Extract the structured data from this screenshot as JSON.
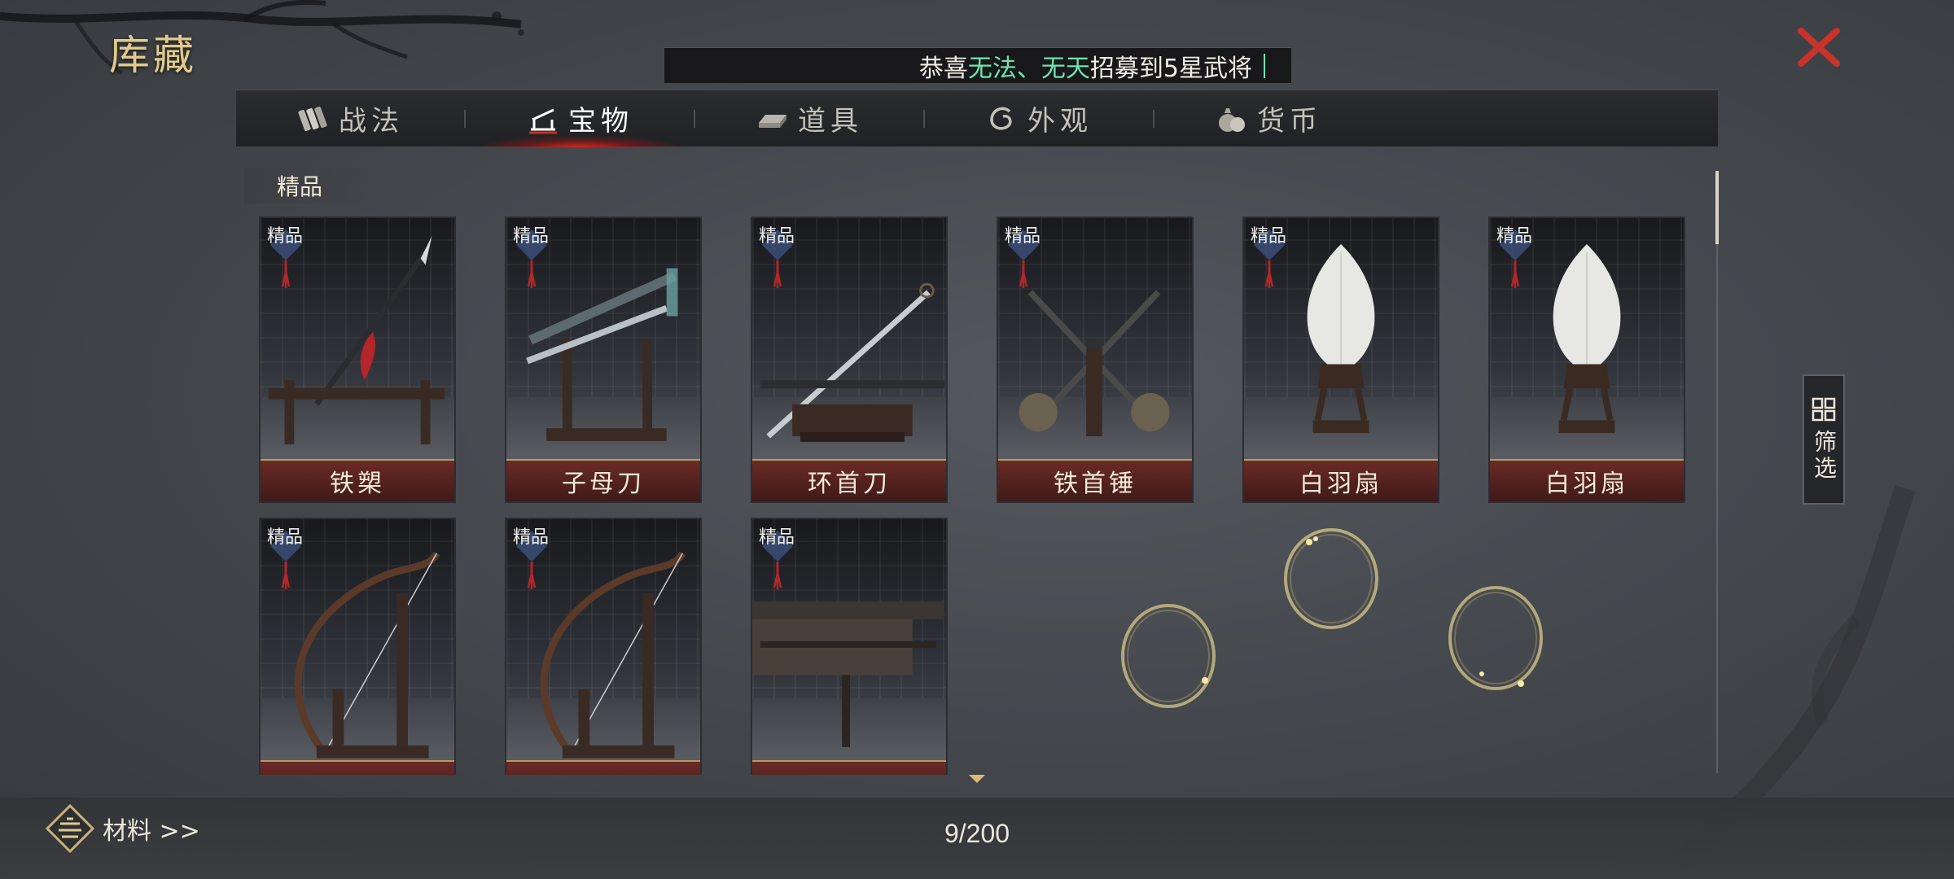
{
  "page": {
    "title": "库藏"
  },
  "announcement": {
    "prefix": "恭喜",
    "player1": "无法",
    "separator": "、",
    "player2": "无天",
    "suffix": "招募到5星武将"
  },
  "tabs": [
    {
      "label": "战法",
      "icon": "scroll-bundle-icon",
      "active": false
    },
    {
      "label": "宝物",
      "icon": "treasure-stand-icon",
      "active": true
    },
    {
      "label": "道具",
      "icon": "ingot-icon",
      "active": false
    },
    {
      "label": "外观",
      "icon": "swirl-icon",
      "active": false
    },
    {
      "label": "货币",
      "icon": "money-bag-icon",
      "active": false
    }
  ],
  "section": {
    "label": "精品"
  },
  "badge_text": "精品",
  "items": [
    {
      "name": "铁槊",
      "art": "spear"
    },
    {
      "name": "子母刀",
      "art": "twin-swords"
    },
    {
      "name": "环首刀",
      "art": "ring-pommel-sword"
    },
    {
      "name": "铁首锤",
      "art": "hammers"
    },
    {
      "name": "白羽扇",
      "art": "feather-fan"
    },
    {
      "name": "白羽扇",
      "art": "feather-fan"
    },
    {
      "name": "",
      "art": "bow"
    },
    {
      "name": "",
      "art": "bow"
    },
    {
      "name": "",
      "art": "crossbow"
    }
  ],
  "filter": {
    "label": "筛选"
  },
  "bottom": {
    "materials_label": "材料 >>",
    "count": "9/200"
  },
  "colors": {
    "gold": "#e3c98c",
    "accent_red": "#d12a22",
    "highlight_green": "#6fe3b2"
  }
}
